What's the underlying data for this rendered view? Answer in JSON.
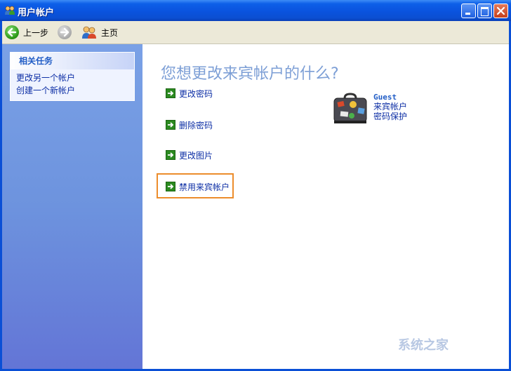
{
  "window": {
    "title": "用户帐户"
  },
  "toolbar": {
    "back_label": "上一步",
    "home_label": "主页"
  },
  "sidebar": {
    "section_title": "相关任务",
    "links": [
      "更改另一个帐户",
      "创建一个新帐户"
    ]
  },
  "main": {
    "heading": "您想更改来宾帐户的什么?",
    "actions": [
      "更改密码",
      "删除密码",
      "更改图片",
      "禁用来宾帐户"
    ],
    "highlighted_action": "禁用来宾帐户"
  },
  "account": {
    "name": "Guest",
    "type": "来宾帐户",
    "status": "密码保护"
  },
  "watermark": "系统之家",
  "colors": {
    "title_bar": "#0a53de",
    "heading": "#7d9fd6",
    "link": "#0c2ea5",
    "highlight": "#ec8d2c"
  }
}
